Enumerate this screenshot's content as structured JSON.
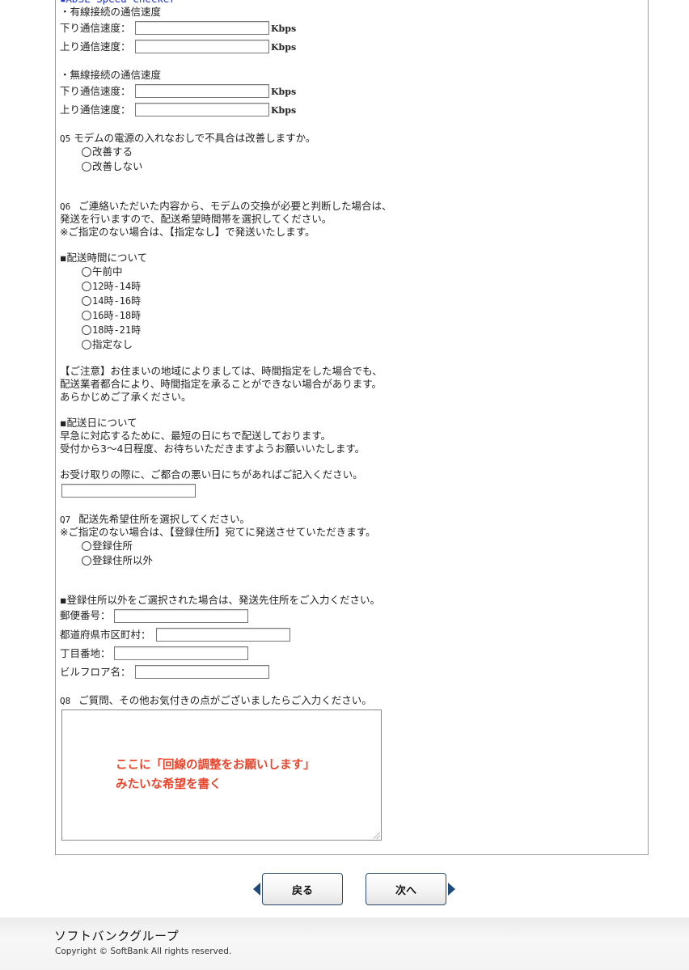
{
  "speed_checker": {
    "heading": "▪ADSL Speed Checker",
    "wired": {
      "label": "・有線接続の通信速度",
      "down_label": "下り通信速度：",
      "down_value": "",
      "up_label": "上り通信速度：",
      "up_value": "",
      "unit": "Kbps"
    },
    "wireless": {
      "label": "・無線接続の通信速度",
      "down_label": "下り通信速度：",
      "down_value": "",
      "up_label": "上り通信速度：",
      "up_value": "",
      "unit": "Kbps"
    }
  },
  "q5": {
    "num": "Q5",
    "question": "モデムの電源の入れなおしで不具合は改善しますか。",
    "options": [
      "改善する",
      "改善しない"
    ]
  },
  "q6": {
    "num": "Q6",
    "line1": "ご連絡いただいた内容から、モデムの交換が必要と判断した場合は、",
    "line2": "発送を行いますので、配送希望時間帯を選択してください。",
    "line3": "※ご指定のない場合は、【指定なし】で発送いたします。",
    "time_heading": "▪配送時間について",
    "time_options": [
      "午前中",
      "12時-14時",
      "14時-16時",
      "16時-18時",
      "18時-21時",
      "指定なし"
    ],
    "notice1": "【ご注意】お住まいの地域によりましては、時間指定をした場合でも、",
    "notice2": "配送業者都合により、時間指定を承ることができない場合があります。",
    "notice3": "あらかじめご了承ください。",
    "day_heading": "▪配送日について",
    "day1": "早急に対応するために、最短の日にちで配送しております。",
    "day2": "受付から3〜4日程度、お待ちいただきますようお願いいたします。",
    "bad_day_label": "お受け取りの際に、ご都合の悪い日にちがあればご記入ください。",
    "bad_day_value": ""
  },
  "q7": {
    "num": "Q7",
    "question": "配送先希望住所を選択してください。",
    "note": "※ご指定のない場合は、【登録住所】宛てに発送させていただきます。",
    "options": [
      "登録住所",
      "登録住所以外"
    ],
    "address_heading": "▪登録住所以外をご選択された場合は、発送先住所をご入力ください。",
    "fields": {
      "postal_label": "郵便番号：",
      "postal_value": "",
      "city_label": "都道府県市区町村：",
      "city_value": "",
      "block_label": "丁目番地：",
      "block_value": "",
      "building_label": "ビルフロア名：",
      "building_value": ""
    }
  },
  "q8": {
    "num": "Q8",
    "question": "ご質問、その他お気付きの点がございましたらご入力ください。",
    "value": "",
    "annotation_line1": "ここに「回線の調整をお願いします」",
    "annotation_line2": "みたいな希望を書く"
  },
  "nav": {
    "back_label": "戻る",
    "next_label": "次へ"
  },
  "footer": {
    "brand": "ソフトバンクグループ",
    "copyright": "Copyright © SoftBank All rights reserved."
  },
  "colors": {
    "annotation": "#e8452c",
    "nav_arrow": "#1c4a7a",
    "heading_link": "#2233cc"
  }
}
